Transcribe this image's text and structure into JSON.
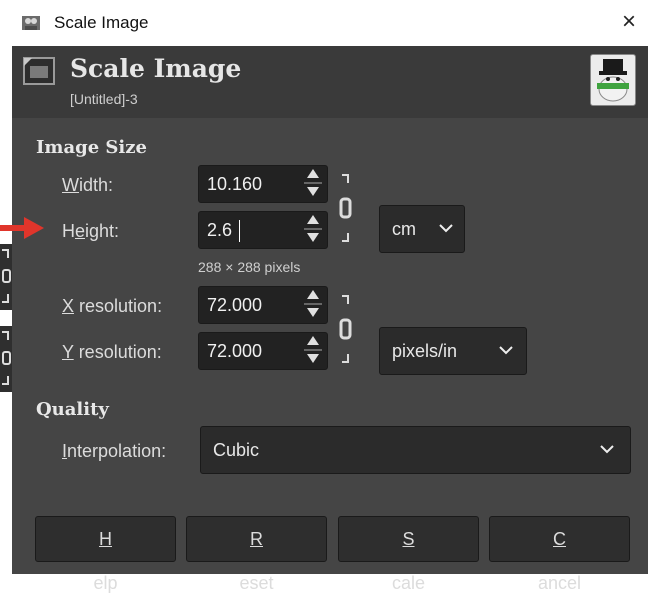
{
  "window": {
    "title": "Scale Image",
    "close_glyph": "×"
  },
  "header": {
    "title": "Scale Image",
    "subtitle": "[Untitled]-3"
  },
  "image_size": {
    "section_label": "Image Size",
    "width": {
      "label_pre": "",
      "label_u": "W",
      "label_post": "idth:",
      "value": "10.160"
    },
    "height": {
      "label_pre": "H",
      "label_u": "e",
      "label_post": "ight:",
      "value": "2.6"
    },
    "pixels_text": "288 × 288 pixels",
    "unit": "cm",
    "x_res": {
      "label_u": "X",
      "label_post": " resolution:",
      "value": "72.000"
    },
    "y_res": {
      "label_u": "Y",
      "label_post": " resolution:",
      "value": "72.000"
    },
    "res_unit": "pixels/in"
  },
  "quality": {
    "section_label": "Quality",
    "interp": {
      "label_u": "I",
      "label_post": "nterpolation:",
      "value": "Cubic"
    }
  },
  "buttons": {
    "help": {
      "u": "H",
      "rest": "elp"
    },
    "reset": {
      "u": "R",
      "rest": "eset"
    },
    "scale": {
      "u": "S",
      "rest": "cale"
    },
    "cancel": {
      "u": "C",
      "rest": "ancel"
    }
  },
  "colors": {
    "dialog_bg": "#454545",
    "header_bg": "#3a3a3a",
    "field_bg": "#222222",
    "pointer": "#e0352b"
  },
  "icons": {
    "app": "gimp-wilber-icon",
    "header": "image-icon",
    "chain": "chain-link-icon",
    "arrow": "pointer-arrow-icon"
  }
}
